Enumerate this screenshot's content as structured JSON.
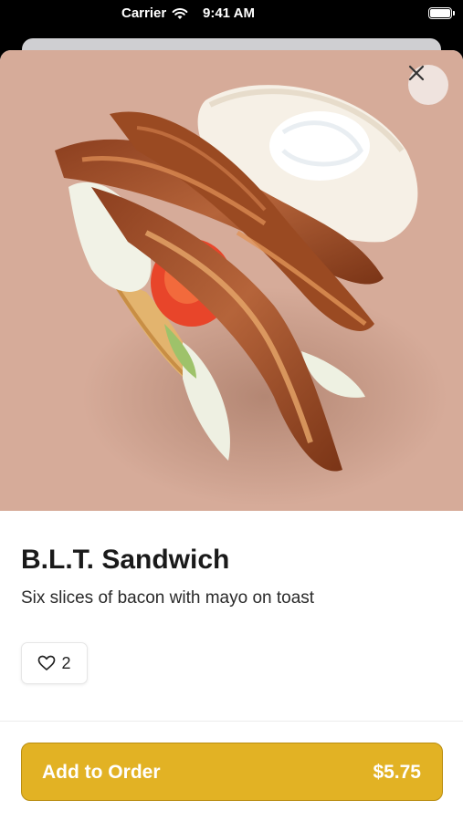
{
  "status_bar": {
    "carrier": "Carrier",
    "time": "9:41 AM",
    "icons": [
      "wifi-icon",
      "battery-icon"
    ]
  },
  "item": {
    "name": "B.L.T. Sandwich",
    "description": "Six slices of bacon with mayo on toast",
    "likes": "2",
    "hero_bg_color": "#d6ab99"
  },
  "actions": {
    "close_icon": "close-icon",
    "like_icon": "heart-icon",
    "add_to_order_label": "Add to Order",
    "price": "$5.75",
    "button_color": "#e2b224"
  }
}
